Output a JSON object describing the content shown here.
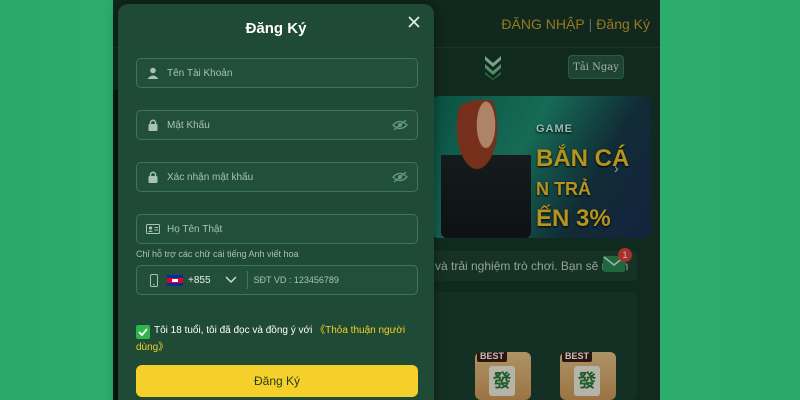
{
  "header": {
    "login_label": "ĐĂNG NHẬP",
    "separator": "|",
    "register_label": "Đăng Ký"
  },
  "download_button": "Tải Ngay",
  "marquee_text": "và trải nghiệm trò chơi. Bạn sẽ nhận",
  "notification_count": "1",
  "banner": {
    "line1": "GAME",
    "line2": "BẮN CÁ",
    "line3": "N TRẢ",
    "line4": "ẾN 3%"
  },
  "game_cards": [
    {
      "tag": "BEST",
      "tile": "發"
    },
    {
      "tag": "BEST",
      "tile": "發"
    }
  ],
  "modal": {
    "title": "Đăng Ký",
    "username_placeholder": "Tên Tài Khoản",
    "password_placeholder": "Mật Khẩu",
    "confirm_placeholder": "Xác nhận mật khẩu",
    "fullname_placeholder": "Họ Tên Thật",
    "hint": "Chỉ hỗ trợ các chữ cái tiếng Anh viết hoa",
    "dial_code": "+855",
    "phone_placeholder": "SĐT VD : 123456789",
    "agree_text": "Tôi 18 tuổi, tôi đã đọc và đồng ý với",
    "agree_link": "《Thỏa thuận người dùng》",
    "submit_label": "Đăng Ký"
  },
  "colors": {
    "accent": "#f5d02a",
    "modal_bg": "#1f4a35",
    "checkbox": "#2fb54e"
  }
}
